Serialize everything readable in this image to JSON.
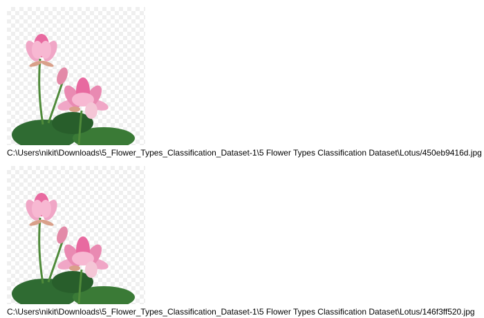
{
  "entries": [
    {
      "image_icon": "lotus-flower-image",
      "path": "C:\\Users\\nikit\\Downloads\\5_Flower_Types_Classification_Dataset-1\\5 Flower Types Classification Dataset\\Lotus/450eb9416d.jpg"
    },
    {
      "image_icon": "lotus-flower-image",
      "path": "C:\\Users\\nikit\\Downloads\\5_Flower_Types_Classification_Dataset-1\\5 Flower Types Classification Dataset\\Lotus/146f3ff520.jpg"
    }
  ],
  "colors": {
    "petal": "#e86aa0",
    "petal_light": "#f7b8d2",
    "leaf": "#2f6b32",
    "stem": "#4f8a3a"
  }
}
